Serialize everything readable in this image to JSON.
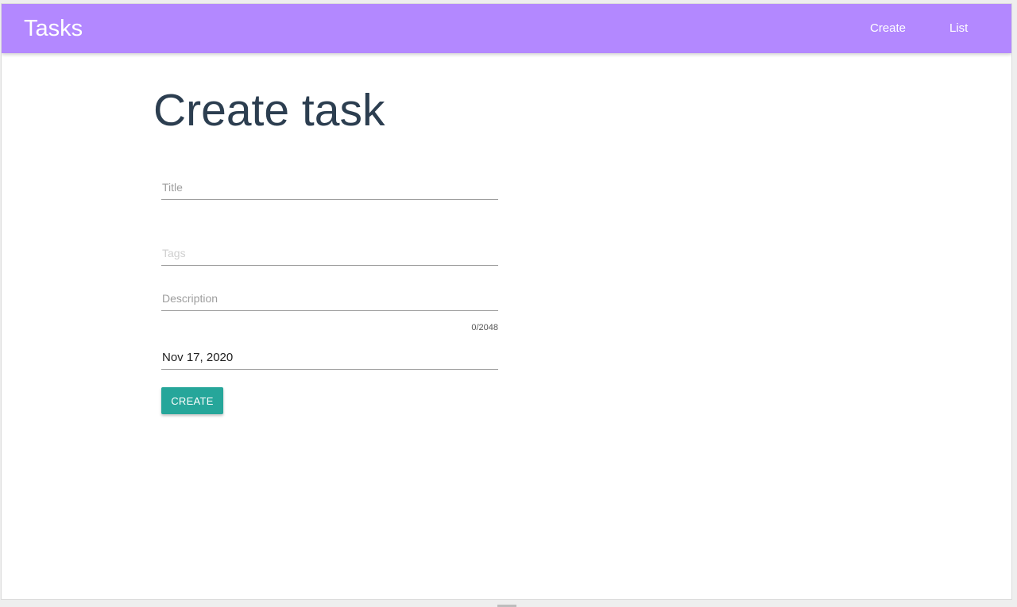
{
  "app": {
    "brand": "Tasks"
  },
  "nav": {
    "create_label": "Create",
    "list_label": "List"
  },
  "page": {
    "title": "Create task"
  },
  "form": {
    "title_placeholder": "Title",
    "tags_placeholder": "Tags",
    "description_placeholder": "Description",
    "description_counter": "0/2048",
    "date_value": "Nov 17, 2020",
    "submit_label": "CREATE"
  },
  "colors": {
    "navbar": "#b388ff",
    "button": "#26a69a",
    "title_text": "#2c3e50"
  }
}
